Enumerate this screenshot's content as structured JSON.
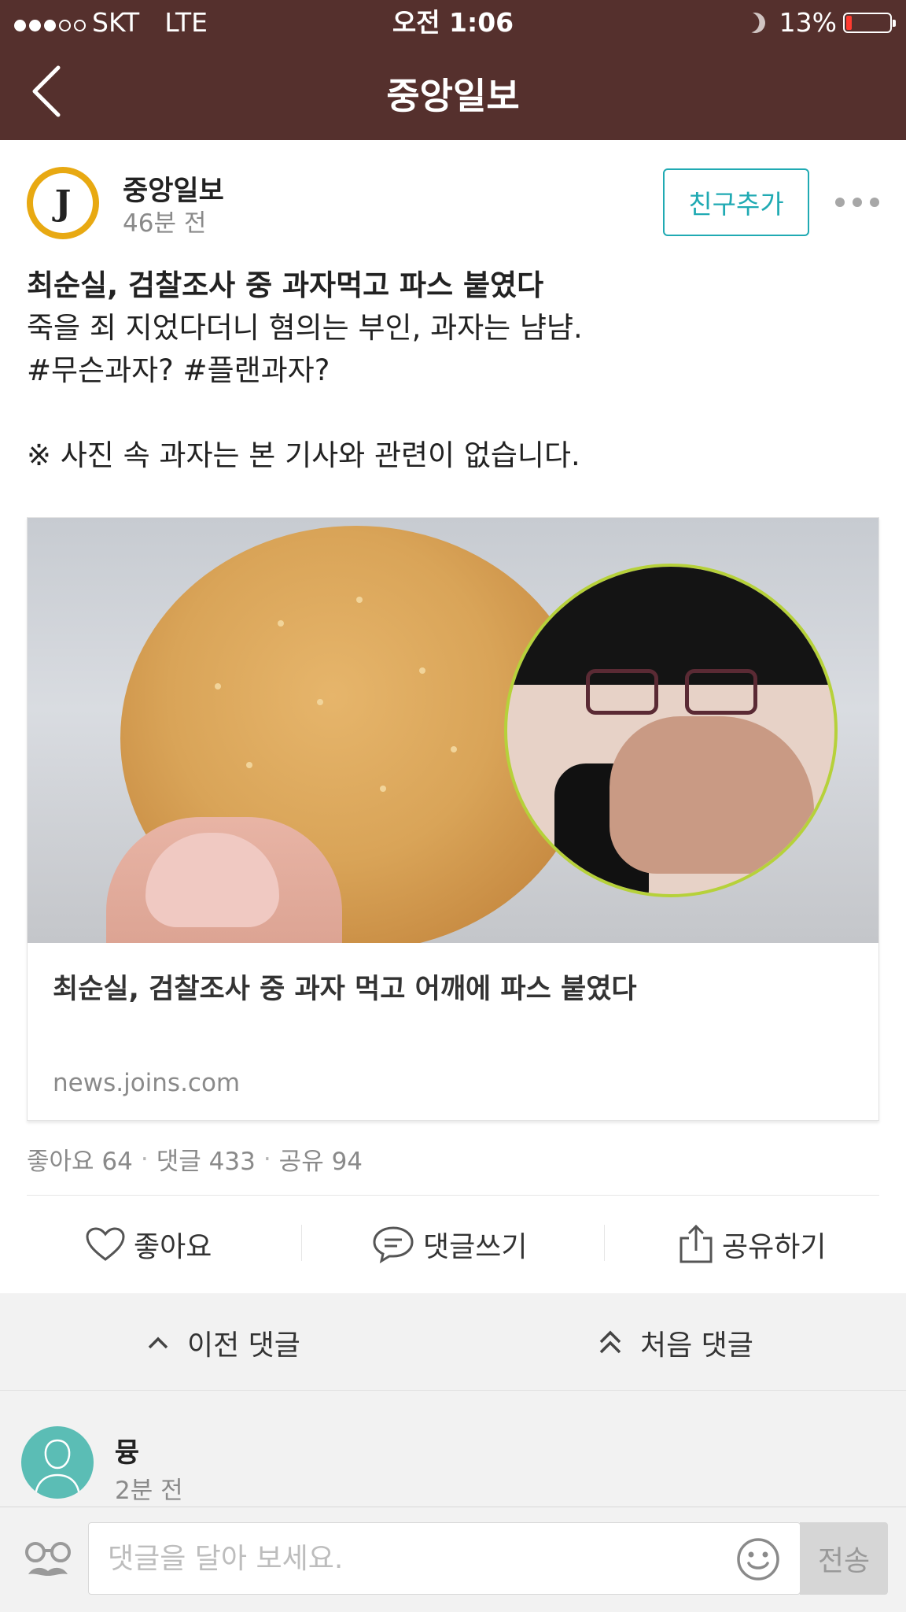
{
  "status_bar": {
    "carrier": "SKT",
    "network": "LTE",
    "time": "오전 1:06",
    "battery": "13%",
    "battery_level": 0.13,
    "signal_bars_filled": 3,
    "signal_bars_total": 5
  },
  "nav": {
    "title": "중앙일보"
  },
  "post": {
    "publisher": "중앙일보",
    "logo_letter": "J",
    "time_ago": "46분 전",
    "friend_button": "친구추가",
    "text_lines": [
      "최순실, 검찰조사 중 과자먹고 파스 붙였다",
      "죽을 죄 지었다더니 혐의는 부인, 과자는 냠냠.",
      "#무슨과자? #플랜과자?",
      "",
      "※ 사진 속 과자는 본 기사와 관련이 없습니다."
    ]
  },
  "link_card": {
    "title": "최순실, 검찰조사 중 과자 먹고 어깨에 파스 붙였다",
    "source": "news.joins.com"
  },
  "stats": {
    "likes": "좋아요 64",
    "comments": "댓글 433",
    "shares": "공유 94"
  },
  "actions": {
    "like": "좋아요",
    "comment": "댓글쓰기",
    "share": "공유하기"
  },
  "comment_nav": {
    "previous": "이전 댓글",
    "first": "처음 댓글"
  },
  "comment": {
    "author": "뮹",
    "time_ago": "2분 전"
  },
  "input": {
    "placeholder": "댓글을 달아 보세요.",
    "send": "전송"
  },
  "colors": {
    "header_bg": "#55302d",
    "accent": "#20aab3",
    "logo": "#e8a912",
    "avatar": "#5bbdb5",
    "battery_low": "#ff3b30"
  }
}
